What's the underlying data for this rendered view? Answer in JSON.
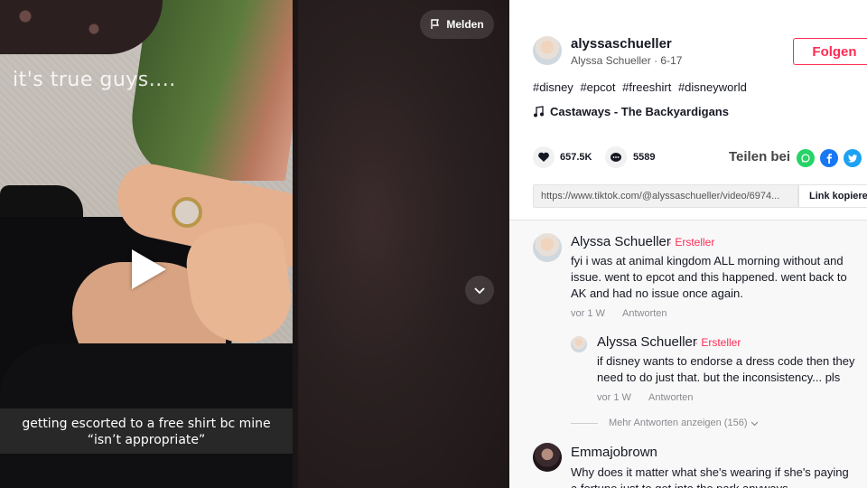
{
  "video": {
    "overlay_top": "it's true guys....",
    "caption": "getting escorted to a free shirt bc mine “isn’t appropriate”",
    "report_label": "Melden"
  },
  "author": {
    "username": "alyssaschueller",
    "display_name": "Alyssa Schueller",
    "date": "6-17",
    "follow_label": "Folgen"
  },
  "hashtags": [
    "#disney",
    "#epcot",
    "#freeshirt",
    "#disneyworld"
  ],
  "music": "Castaways - The Backyardigans",
  "stats": {
    "likes": "657.5K",
    "comments": "5589"
  },
  "share": {
    "label": "Teilen bei",
    "link": "https://www.tiktok.com/@alyssaschueller/video/6974...",
    "copy_label": "Link kopieren"
  },
  "comments": [
    {
      "author": "Alyssa Schueller",
      "badge": "Ersteller",
      "text": "fyi i was at animal kingdom ALL morning without and issue. went to epcot and this happened. went back to AK and had no issue once again.",
      "time": "vor 1 W",
      "reply_label": "Antworten",
      "replies": [
        {
          "author": "Alyssa Schueller",
          "badge": "Ersteller",
          "text": "if disney wants to endorse a dress code then they need to do just that. but the inconsistency... pls",
          "time": "vor 1 W",
          "reply_label": "Antworten"
        }
      ],
      "more_replies": "Mehr Antworten anzeigen (156)"
    },
    {
      "author": "Emmajobrown",
      "text": "Why does it matter what she's wearing if she's paying a fortune just to get into the park anyways"
    }
  ],
  "colors": {
    "accent": "#fe2c55",
    "text": "#161823",
    "muted": "#8a8b91"
  }
}
